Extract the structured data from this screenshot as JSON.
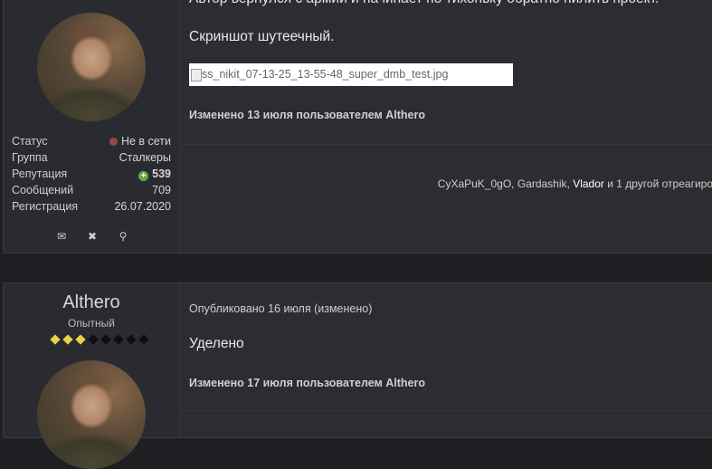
{
  "post1": {
    "body_line1": "Автор вернулся с армии и начинает по тихоньку обратно пилить проект.",
    "body_line2": "Скриншот шутеечный.",
    "image_alt": "ss_nikit_07-13-25_13-55-48_super_dmb_test.jpg",
    "edited_note": "Изменено 13 июля пользователем Althero",
    "reactions_pre": "CyXaPuK_0gO, Gardashik, ",
    "reactions_user": "Vlador",
    "reactions_post": " и 1 другой отреагиро",
    "author_info": [
      {
        "label": "Статус",
        "value": "Не в сети"
      },
      {
        "label": "Группа",
        "value": "Сталкеры"
      },
      {
        "label": "Репутация",
        "value": "539"
      },
      {
        "label": "Сообщений",
        "value": "709"
      },
      {
        "label": "Регистрация",
        "value": "26.07.2020"
      }
    ],
    "actions": [
      "envelope-icon",
      "close-circle-icon",
      "search-icon"
    ]
  },
  "post2": {
    "author_name": "Althero",
    "author_rank": "Опытный",
    "rank_pips_filled": 3,
    "rank_pips_total": 8,
    "published": "Опубликовано 16 июля (изменено)",
    "body": "Уделено",
    "edited_note": "Изменено 17 июля пользователем Althero"
  },
  "colors": {
    "offline_dot": "#8b4a48",
    "reputation": "#8cbf5a",
    "pip_on": "#e8d24a"
  }
}
